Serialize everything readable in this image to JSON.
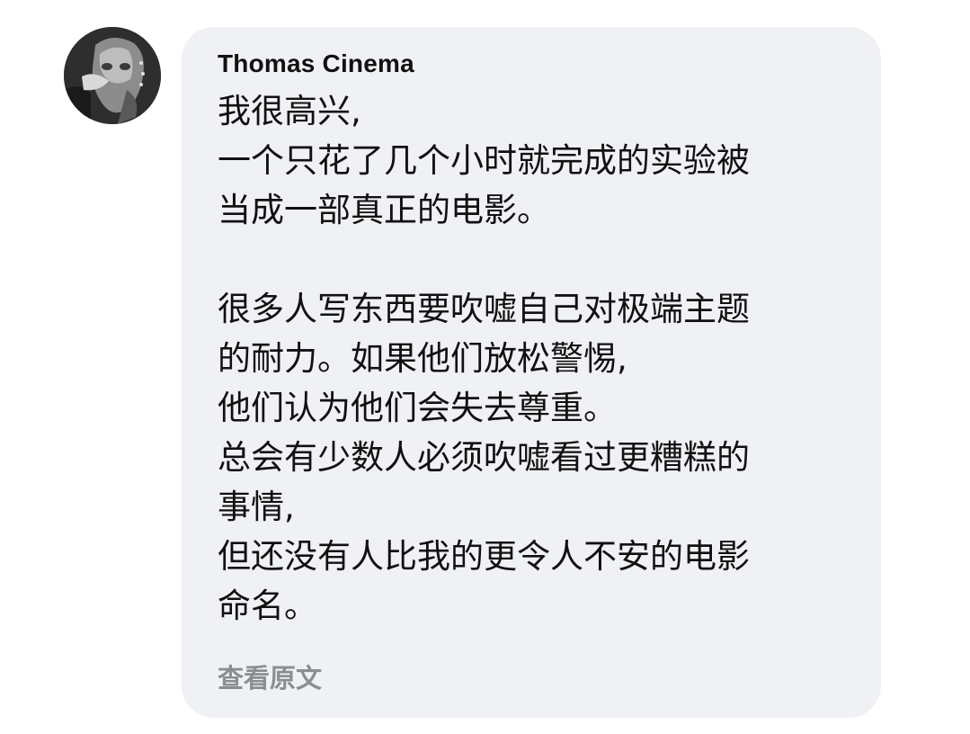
{
  "comment": {
    "author": "Thomas Cinema",
    "avatar_icon": "avatar-photo-icon",
    "lines": [
      "我很高兴,",
      "一个只花了几个小时就完成的实验被",
      "当成一部真正的电影。",
      "",
      "很多人写东西要吹嘘自己对极端主题",
      "的耐力。如果他们放松警惕,",
      "他们认为他们会失去尊重。",
      "总会有少数人必须吹嘘看过更糟糕的",
      "事情,",
      "但还没有人比我的更令人不安的电影",
      "命名。"
    ],
    "see_original_label": "查看原文"
  },
  "colors": {
    "bubble_background": "#eff1f4",
    "text": "#111111",
    "link_gray": "#8a8d92"
  }
}
